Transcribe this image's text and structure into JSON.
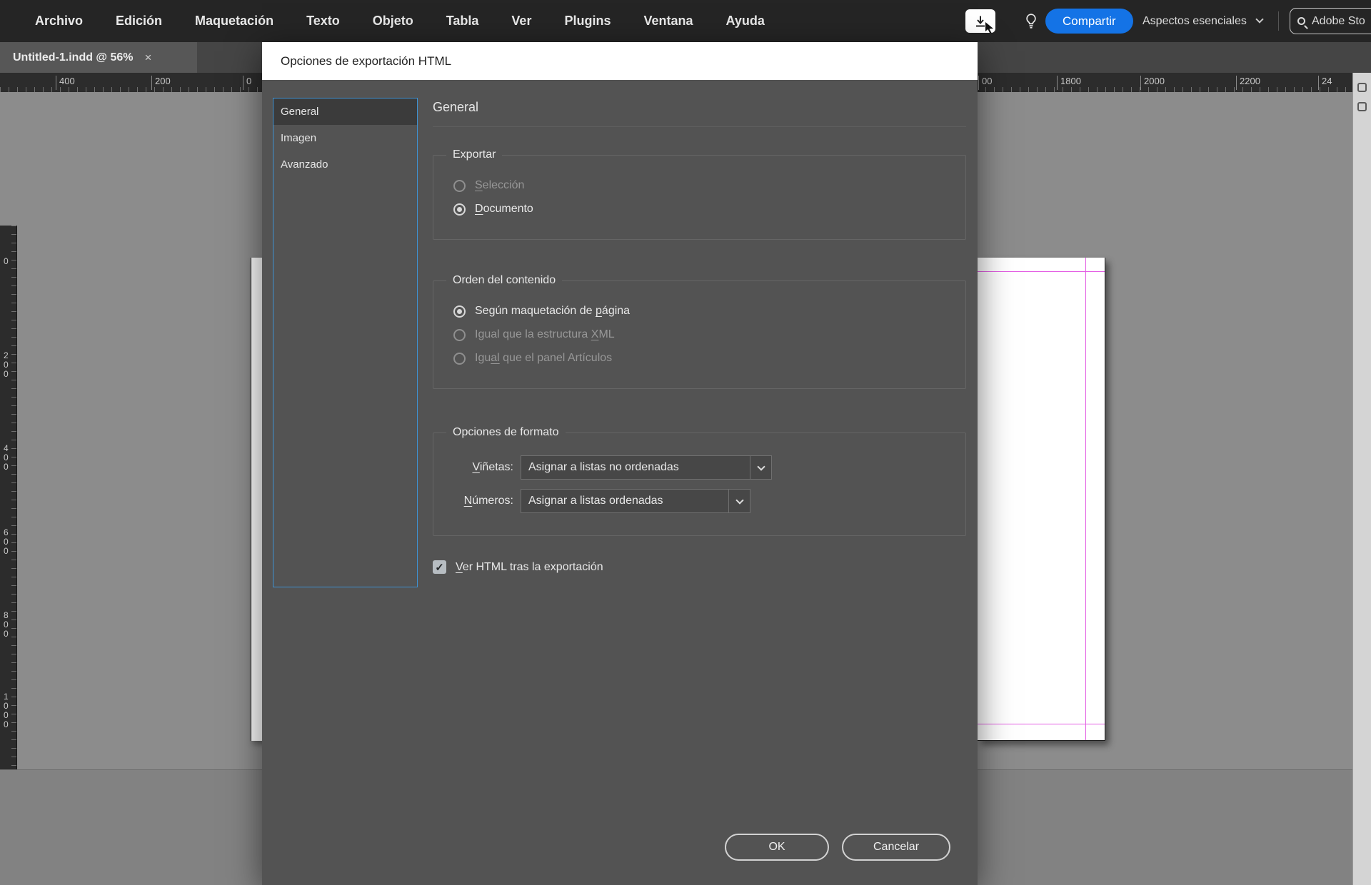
{
  "colors": {
    "accent_blue": "#1473e6",
    "focus_blue": "#3f92d2",
    "guide_magenta": "#e35ee3"
  },
  "menu": {
    "items": [
      "Archivo",
      "Edición",
      "Maquetación",
      "Texto",
      "Objeto",
      "Tabla",
      "Ver",
      "Plugins",
      "Ventana",
      "Ayuda"
    ],
    "share_label": "Compartir",
    "workspace_label": "Aspectos esenciales",
    "search_text": "Adobe Sto"
  },
  "tab": {
    "title": "Untitled-1.indd @ 56%",
    "close": "×"
  },
  "rulers": {
    "horizontal_left": [
      "400",
      "200",
      "0"
    ],
    "horizontal_right": [
      "00",
      "1800",
      "2000",
      "2200",
      "24"
    ],
    "vertical": [
      "0",
      "200",
      "400",
      "600",
      "800",
      "1000"
    ]
  },
  "dialog": {
    "title": "Opciones de exportación HTML",
    "nav": [
      {
        "label": "General",
        "selected": true
      },
      {
        "label": "Imagen",
        "selected": false
      },
      {
        "label": "Avanzado",
        "selected": false
      }
    ],
    "heading": "General",
    "export_group": {
      "legend": "Exportar",
      "options": [
        {
          "label": "<u>S</u>elección",
          "disabled": true,
          "selected": false
        },
        {
          "label": "<u>D</u>ocumento",
          "disabled": false,
          "selected": true
        }
      ]
    },
    "order_group": {
      "legend": "Orden del contenido",
      "options": [
        {
          "label": "Según maquetación de <u>p</u>ágina",
          "disabled": false,
          "selected": true
        },
        {
          "label": "Igual que la estructura <u>X</u>ML",
          "disabled": true,
          "selected": false
        },
        {
          "label": "Igu<u>al</u> que el panel Artículos",
          "disabled": true,
          "selected": false
        }
      ]
    },
    "format_group": {
      "legend": "Opciones de formato",
      "rows": [
        {
          "label": "<u>V</u>iñetas:",
          "value": "Asignar a listas no ordenadas"
        },
        {
          "label": "<u>N</u>úmeros:",
          "value": "Asignar a listas ordenadas"
        }
      ]
    },
    "view_checkbox": {
      "label": "<u>V</u>er HTML tras la exportación",
      "checked": true
    },
    "buttons": {
      "ok": "OK",
      "cancel": "Cancelar"
    }
  }
}
